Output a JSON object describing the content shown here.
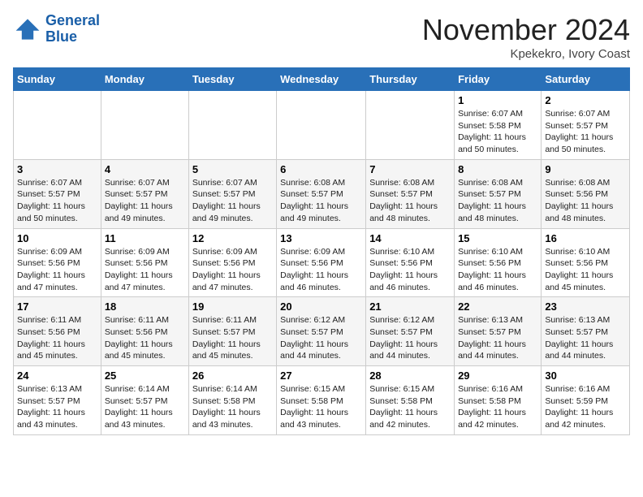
{
  "header": {
    "logo_line1": "General",
    "logo_line2": "Blue",
    "month_title": "November 2024",
    "location": "Kpekekro, Ivory Coast"
  },
  "weekdays": [
    "Sunday",
    "Monday",
    "Tuesday",
    "Wednesday",
    "Thursday",
    "Friday",
    "Saturday"
  ],
  "weeks": [
    [
      {
        "day": "",
        "info": ""
      },
      {
        "day": "",
        "info": ""
      },
      {
        "day": "",
        "info": ""
      },
      {
        "day": "",
        "info": ""
      },
      {
        "day": "",
        "info": ""
      },
      {
        "day": "1",
        "info": "Sunrise: 6:07 AM\nSunset: 5:58 PM\nDaylight: 11 hours\nand 50 minutes."
      },
      {
        "day": "2",
        "info": "Sunrise: 6:07 AM\nSunset: 5:57 PM\nDaylight: 11 hours\nand 50 minutes."
      }
    ],
    [
      {
        "day": "3",
        "info": "Sunrise: 6:07 AM\nSunset: 5:57 PM\nDaylight: 11 hours\nand 50 minutes."
      },
      {
        "day": "4",
        "info": "Sunrise: 6:07 AM\nSunset: 5:57 PM\nDaylight: 11 hours\nand 49 minutes."
      },
      {
        "day": "5",
        "info": "Sunrise: 6:07 AM\nSunset: 5:57 PM\nDaylight: 11 hours\nand 49 minutes."
      },
      {
        "day": "6",
        "info": "Sunrise: 6:08 AM\nSunset: 5:57 PM\nDaylight: 11 hours\nand 49 minutes."
      },
      {
        "day": "7",
        "info": "Sunrise: 6:08 AM\nSunset: 5:57 PM\nDaylight: 11 hours\nand 48 minutes."
      },
      {
        "day": "8",
        "info": "Sunrise: 6:08 AM\nSunset: 5:57 PM\nDaylight: 11 hours\nand 48 minutes."
      },
      {
        "day": "9",
        "info": "Sunrise: 6:08 AM\nSunset: 5:56 PM\nDaylight: 11 hours\nand 48 minutes."
      }
    ],
    [
      {
        "day": "10",
        "info": "Sunrise: 6:09 AM\nSunset: 5:56 PM\nDaylight: 11 hours\nand 47 minutes."
      },
      {
        "day": "11",
        "info": "Sunrise: 6:09 AM\nSunset: 5:56 PM\nDaylight: 11 hours\nand 47 minutes."
      },
      {
        "day": "12",
        "info": "Sunrise: 6:09 AM\nSunset: 5:56 PM\nDaylight: 11 hours\nand 47 minutes."
      },
      {
        "day": "13",
        "info": "Sunrise: 6:09 AM\nSunset: 5:56 PM\nDaylight: 11 hours\nand 46 minutes."
      },
      {
        "day": "14",
        "info": "Sunrise: 6:10 AM\nSunset: 5:56 PM\nDaylight: 11 hours\nand 46 minutes."
      },
      {
        "day": "15",
        "info": "Sunrise: 6:10 AM\nSunset: 5:56 PM\nDaylight: 11 hours\nand 46 minutes."
      },
      {
        "day": "16",
        "info": "Sunrise: 6:10 AM\nSunset: 5:56 PM\nDaylight: 11 hours\nand 45 minutes."
      }
    ],
    [
      {
        "day": "17",
        "info": "Sunrise: 6:11 AM\nSunset: 5:56 PM\nDaylight: 11 hours\nand 45 minutes."
      },
      {
        "day": "18",
        "info": "Sunrise: 6:11 AM\nSunset: 5:56 PM\nDaylight: 11 hours\nand 45 minutes."
      },
      {
        "day": "19",
        "info": "Sunrise: 6:11 AM\nSunset: 5:57 PM\nDaylight: 11 hours\nand 45 minutes."
      },
      {
        "day": "20",
        "info": "Sunrise: 6:12 AM\nSunset: 5:57 PM\nDaylight: 11 hours\nand 44 minutes."
      },
      {
        "day": "21",
        "info": "Sunrise: 6:12 AM\nSunset: 5:57 PM\nDaylight: 11 hours\nand 44 minutes."
      },
      {
        "day": "22",
        "info": "Sunrise: 6:13 AM\nSunset: 5:57 PM\nDaylight: 11 hours\nand 44 minutes."
      },
      {
        "day": "23",
        "info": "Sunrise: 6:13 AM\nSunset: 5:57 PM\nDaylight: 11 hours\nand 44 minutes."
      }
    ],
    [
      {
        "day": "24",
        "info": "Sunrise: 6:13 AM\nSunset: 5:57 PM\nDaylight: 11 hours\nand 43 minutes."
      },
      {
        "day": "25",
        "info": "Sunrise: 6:14 AM\nSunset: 5:57 PM\nDaylight: 11 hours\nand 43 minutes."
      },
      {
        "day": "26",
        "info": "Sunrise: 6:14 AM\nSunset: 5:58 PM\nDaylight: 11 hours\nand 43 minutes."
      },
      {
        "day": "27",
        "info": "Sunrise: 6:15 AM\nSunset: 5:58 PM\nDaylight: 11 hours\nand 43 minutes."
      },
      {
        "day": "28",
        "info": "Sunrise: 6:15 AM\nSunset: 5:58 PM\nDaylight: 11 hours\nand 42 minutes."
      },
      {
        "day": "29",
        "info": "Sunrise: 6:16 AM\nSunset: 5:58 PM\nDaylight: 11 hours\nand 42 minutes."
      },
      {
        "day": "30",
        "info": "Sunrise: 6:16 AM\nSunset: 5:59 PM\nDaylight: 11 hours\nand 42 minutes."
      }
    ]
  ]
}
